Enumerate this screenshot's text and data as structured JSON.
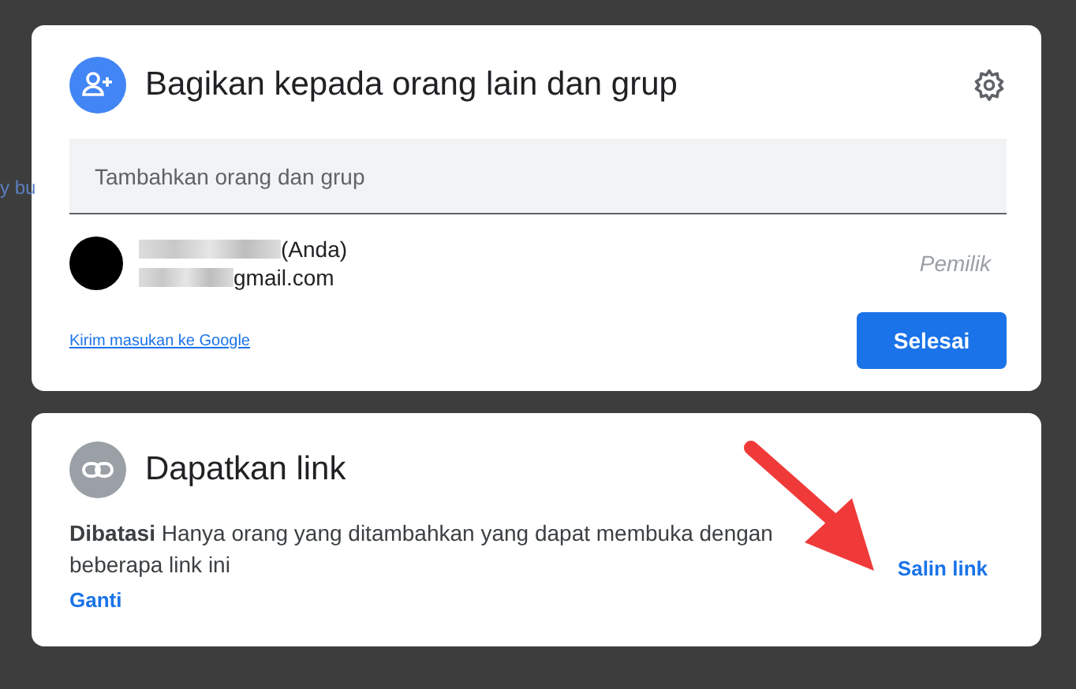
{
  "background": {
    "text": "y bu"
  },
  "share": {
    "title": "Bagikan kepada orang lain dan grup",
    "field": {
      "placeholder": "Tambahkan orang dan grup"
    },
    "people": [
      {
        "name": "(Anda)",
        "email": "gmail.com",
        "role": "Pemilik"
      }
    ],
    "feedback_link": "Kirim masukan ke Google",
    "done_button": "Selesai"
  },
  "link": {
    "title": "Dapatkan link",
    "access": "**Dibatasi** Hanya orang yang ditambahkan yang dapat membuka dengan beberapa link ini",
    "change": "Ganti",
    "copy": "Salin link"
  }
}
